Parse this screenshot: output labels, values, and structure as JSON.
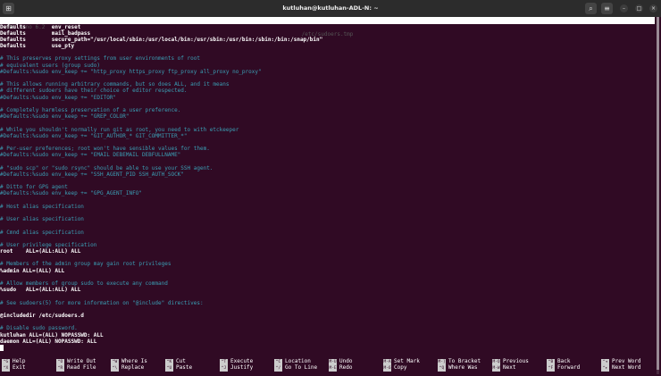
{
  "window": {
    "title": "kutluhan@kutluhan-ADL-N: ~"
  },
  "nano": {
    "version": "GNU nano 6.2",
    "filename": "/etc/sudoers.tmp"
  },
  "lines": [
    {
      "t": "Defaults\tenv_reset",
      "c": false
    },
    {
      "t": "Defaults\tmail_badpass",
      "c": false
    },
    {
      "t": "Defaults\tsecure_path=\"/usr/local/sbin:/usr/local/bin:/usr/sbin:/usr/bin:/sbin:/bin:/snap/bin\"",
      "c": false
    },
    {
      "t": "Defaults\tuse_pty",
      "c": false
    },
    {
      "t": "",
      "c": false
    },
    {
      "t": "# This preserves proxy settings from user environments of root",
      "c": true
    },
    {
      "t": "# equivalent users (group sudo)",
      "c": true
    },
    {
      "t": "#Defaults:%sudo env_keep += \"http_proxy https_proxy ftp_proxy all_proxy no_proxy\"",
      "c": true
    },
    {
      "t": "",
      "c": false
    },
    {
      "t": "# This allows running arbitrary commands, but so does ALL, and it means",
      "c": true
    },
    {
      "t": "# different sudoers have their choice of editor respected.",
      "c": true
    },
    {
      "t": "#Defaults:%sudo env_keep += \"EDITOR\"",
      "c": true
    },
    {
      "t": "",
      "c": false
    },
    {
      "t": "# Completely harmless preservation of a user preference.",
      "c": true
    },
    {
      "t": "#Defaults:%sudo env_keep += \"GREP_COLOR\"",
      "c": true
    },
    {
      "t": "",
      "c": false
    },
    {
      "t": "# While you shouldn't normally run git as root, you need to with etckeeper",
      "c": true
    },
    {
      "t": "#Defaults:%sudo env_keep += \"GIT_AUTHOR_* GIT_COMMITTER_*\"",
      "c": true
    },
    {
      "t": "",
      "c": false
    },
    {
      "t": "# Per-user preferences; root won't have sensible values for them.",
      "c": true
    },
    {
      "t": "#Defaults:%sudo env_keep += \"EMAIL DEBEMAIL DEBFULLNAME\"",
      "c": true
    },
    {
      "t": "",
      "c": false
    },
    {
      "t": "# \"sudo scp\" or \"sudo rsync\" should be able to use your SSH agent.",
      "c": true
    },
    {
      "t": "#Defaults:%sudo env_keep += \"SSH_AGENT_PID SSH_AUTH_SOCK\"",
      "c": true
    },
    {
      "t": "",
      "c": false
    },
    {
      "t": "# Ditto for GPG agent",
      "c": true
    },
    {
      "t": "#Defaults:%sudo env_keep += \"GPG_AGENT_INFO\"",
      "c": true
    },
    {
      "t": "",
      "c": false
    },
    {
      "t": "# Host alias specification",
      "c": true
    },
    {
      "t": "",
      "c": false
    },
    {
      "t": "# User alias specification",
      "c": true
    },
    {
      "t": "",
      "c": false
    },
    {
      "t": "# Cmnd alias specification",
      "c": true
    },
    {
      "t": "",
      "c": false
    },
    {
      "t": "# User privilege specification",
      "c": true
    },
    {
      "t": "root\tALL=(ALL:ALL) ALL",
      "c": false
    },
    {
      "t": "",
      "c": false
    },
    {
      "t": "# Members of the admin group may gain root privileges",
      "c": true
    },
    {
      "t": "%admin ALL=(ALL) ALL",
      "c": false
    },
    {
      "t": "",
      "c": false
    },
    {
      "t": "# Allow members of group sudo to execute any command",
      "c": true
    },
    {
      "t": "%sudo\tALL=(ALL:ALL) ALL",
      "c": false
    },
    {
      "t": "",
      "c": false
    },
    {
      "t": "# See sudoers(5) for more information on \"@include\" directives:",
      "c": true
    },
    {
      "t": "",
      "c": false
    },
    {
      "t": "@includedir /etc/sudoers.d",
      "c": false
    },
    {
      "t": "",
      "c": false
    },
    {
      "t": "# Disable sudo password.",
      "c": true
    },
    {
      "t": "kutluhan ALL=(ALL) NOPASSWD: ALL",
      "c": false
    },
    {
      "t": "daemon ALL=(ALL) NOPASSWD: ALL",
      "c": false
    }
  ],
  "shortcuts": [
    [
      {
        "k": "^G",
        "l": "Help"
      },
      {
        "k": "^X",
        "l": "Exit"
      }
    ],
    [
      {
        "k": "^O",
        "l": "Write Out"
      },
      {
        "k": "^R",
        "l": "Read File"
      }
    ],
    [
      {
        "k": "^W",
        "l": "Where Is"
      },
      {
        "k": "^\\",
        "l": "Replace"
      }
    ],
    [
      {
        "k": "^K",
        "l": "Cut"
      },
      {
        "k": "^U",
        "l": "Paste"
      }
    ],
    [
      {
        "k": "^T",
        "l": "Execute"
      },
      {
        "k": "^J",
        "l": "Justify"
      }
    ],
    [
      {
        "k": "^C",
        "l": "Location"
      },
      {
        "k": "^/",
        "l": "Go To Line"
      }
    ],
    [
      {
        "k": "M-U",
        "l": "Undo"
      },
      {
        "k": "M-E",
        "l": "Redo"
      }
    ],
    [
      {
        "k": "M-A",
        "l": "Set Mark"
      },
      {
        "k": "M-6",
        "l": "Copy"
      }
    ],
    [
      {
        "k": "M-]",
        "l": "To Bracket"
      },
      {
        "k": "^Q",
        "l": "Where Was"
      }
    ],
    [
      {
        "k": "M-Q",
        "l": "Previous"
      },
      {
        "k": "M-W",
        "l": "Next"
      }
    ],
    [
      {
        "k": "^B",
        "l": "Back"
      },
      {
        "k": "^F",
        "l": "Forward"
      }
    ],
    [
      {
        "k": "^◂",
        "l": "Prev Word"
      },
      {
        "k": "^▸",
        "l": "Next Word"
      }
    ]
  ]
}
